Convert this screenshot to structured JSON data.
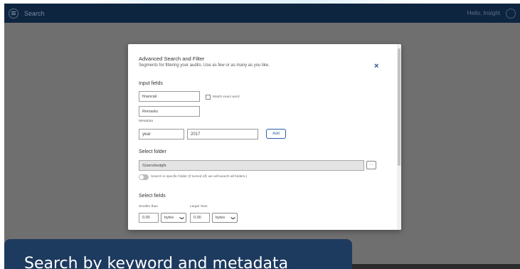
{
  "appbar": {
    "title": "Search",
    "user": "Hello, Insight"
  },
  "modal": {
    "title": "Advanced Search and Filter",
    "subtitle": "Segments for filtering your audits. Use as few or as many as you like.",
    "close": "×",
    "input_fields": {
      "heading": "Input fields",
      "keyword_value": "financial",
      "match_exact_label": "Match exact word",
      "remarks_value": "Remarks",
      "metadata_label": "Metadata",
      "metadata_key_value": "year",
      "metadata_value_value": "2017",
      "add_label": "Add"
    },
    "select_folder": {
      "heading": "Select folder",
      "path_value": "/Users/testgfs",
      "browse_label": "···",
      "toggle_label": "Search in specific folder (If turned off, we will search all folders.)"
    },
    "select_fields": {
      "heading": "Select fields",
      "smaller_label": "Smaller than",
      "larger_label": "Larger than",
      "smaller_value": "0.00",
      "smaller_unit": "bytes",
      "larger_value": "0.00",
      "larger_unit": "bytes"
    }
  },
  "banner": {
    "text": "Search by keyword and metadata"
  },
  "colors": {
    "appbar": "#0e2540",
    "overlay": "#6f6f6f",
    "banner": "#1d3a5f",
    "accent": "#1f4d8f"
  }
}
